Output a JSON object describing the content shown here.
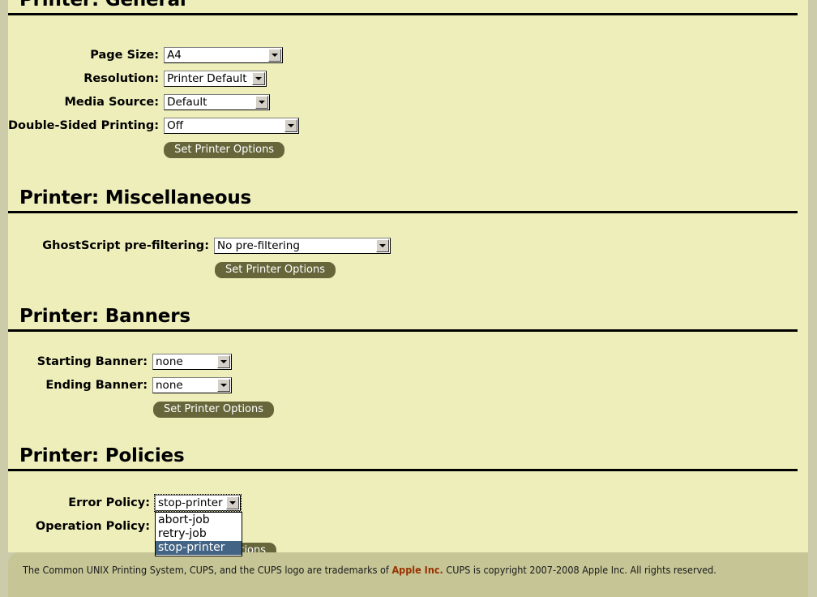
{
  "page": {
    "background_color": "#ccccaa",
    "content_color": "#eeeebb",
    "accent_color": "#66663a",
    "highlight_color": "#436484",
    "link_color": "#993300"
  },
  "sections": [
    {
      "heading": "Printer: General",
      "rows": [
        {
          "label": "Page Size:",
          "value": "A4"
        },
        {
          "label": "Resolution:",
          "value": "Printer Default"
        },
        {
          "label": "Media Source:",
          "value": "Default"
        },
        {
          "label": "Double-Sided Printing:",
          "value": "Off"
        }
      ],
      "button": "Set Printer Options"
    },
    {
      "heading": "Printer: Miscellaneous",
      "rows": [
        {
          "label": "GhostScript pre-filtering:",
          "value": "No pre-filtering"
        }
      ],
      "button": "Set Printer Options"
    },
    {
      "heading": "Printer: Banners",
      "rows": [
        {
          "label": "Starting Banner:",
          "value": "none"
        },
        {
          "label": "Ending Banner:",
          "value": "none"
        }
      ],
      "button": "Set Printer Options"
    },
    {
      "heading": "Printer: Policies",
      "rows": [
        {
          "label": "Error Policy:",
          "value": "stop-printer"
        },
        {
          "label": "Operation Policy:",
          "value": ""
        }
      ],
      "button": "Set Printer Options",
      "open_dropdown": {
        "field": "Error Policy",
        "selected": "stop-printer",
        "options": [
          "abort-job",
          "retry-job",
          "stop-printer"
        ]
      }
    }
  ],
  "footer": {
    "text_before_link": "The Common UNIX Printing System, CUPS, and the CUPS logo are trademarks of ",
    "link": "Apple Inc.",
    "text_after_link": " CUPS is copyright 2007-2008 Apple Inc. All rights reserved."
  }
}
